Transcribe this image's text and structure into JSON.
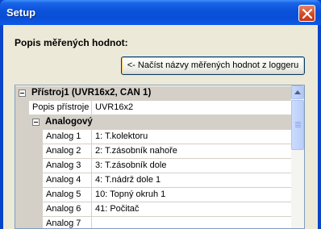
{
  "window": {
    "title": "Setup"
  },
  "main": {
    "section_label": "Popis měřených hodnot:",
    "load_button_label": "<- Načíst názvy měřených hodnot z loggeru"
  },
  "grid": {
    "device_category": "Přístroj1 (UVR16x2, CAN 1)",
    "device_desc_label": "Popis přístroje",
    "device_desc_value": "UVR16x2",
    "analog_category": "Analogový",
    "rows": [
      {
        "name": "Analog 1",
        "value": "1: T.kolektoru"
      },
      {
        "name": "Analog 2",
        "value": "2: T.zásobník nahoře"
      },
      {
        "name": "Analog 3",
        "value": "3: T.zásobník dole"
      },
      {
        "name": "Analog 4",
        "value": "4: T.nádrž dole 1"
      },
      {
        "name": "Analog 5",
        "value": "10: Topný okruh 1"
      },
      {
        "name": "Analog 6",
        "value": "41: Počitač"
      },
      {
        "name": "Analog 7",
        "value": ""
      }
    ]
  },
  "colors": {
    "titlebar": "#0a52da",
    "dialog_bg": "#ece9d8",
    "category_bg": "#d4d0c8"
  },
  "icons": {
    "close": "close-icon",
    "scroll_up": "arrow-up-icon",
    "scroll_grip": "grip-icon"
  }
}
